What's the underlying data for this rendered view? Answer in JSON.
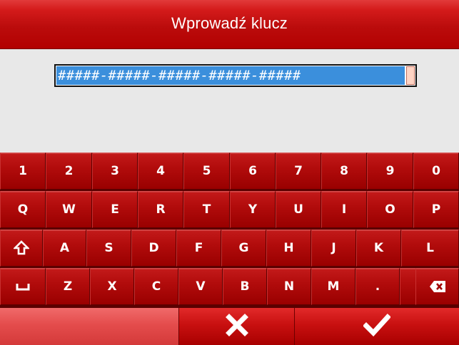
{
  "dialog": {
    "title": "Wprowadź klucz"
  },
  "key_field": {
    "value": "#####-#####-#####-#####-#####"
  },
  "keyboard": {
    "rows": [
      [
        "1",
        "2",
        "3",
        "4",
        "5",
        "6",
        "7",
        "8",
        "9",
        "0"
      ],
      [
        "Q",
        "W",
        "E",
        "R",
        "T",
        "Y",
        "U",
        "I",
        "O",
        "P"
      ],
      [
        "shift-icon",
        "A",
        "S",
        "D",
        "F",
        "G",
        "H",
        "J",
        "K",
        "L"
      ],
      [
        "space-icon",
        "Z",
        "X",
        "C",
        "V",
        "B",
        "N",
        "M",
        ".",
        "-",
        "backspace-icon"
      ]
    ]
  },
  "buttons": {
    "cancel_icon": "close-icon",
    "confirm_icon": "checkmark-icon"
  },
  "colors": {
    "title_bar": "#c41010",
    "key_face": "#b20c0c",
    "input_selection": "#3b8fdc",
    "background": "#e8e8e8"
  }
}
